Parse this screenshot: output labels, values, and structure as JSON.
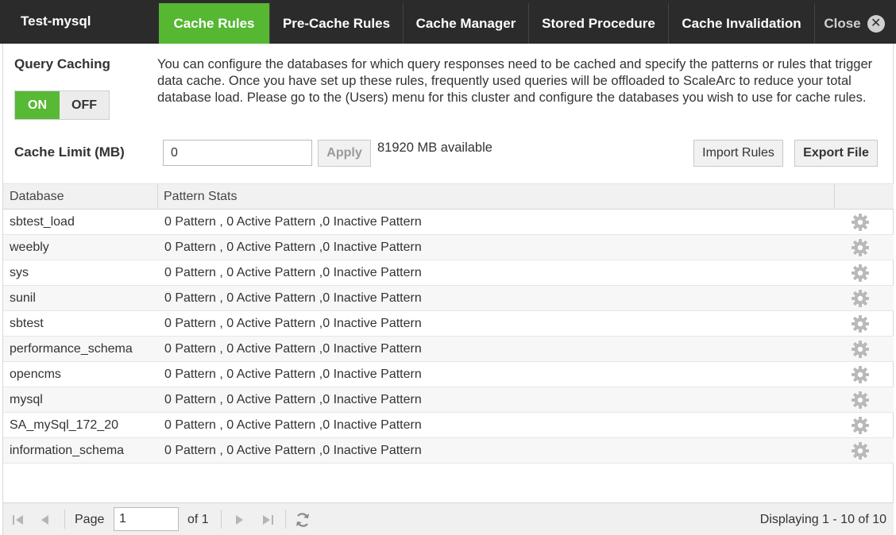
{
  "header": {
    "title": "Test-mysql",
    "tabs": [
      {
        "label": "Cache Rules",
        "active": true
      },
      {
        "label": "Pre-Cache Rules",
        "active": false
      },
      {
        "label": "Cache Manager",
        "active": false
      },
      {
        "label": "Stored Procedure",
        "active": false
      },
      {
        "label": "Cache Invalidation",
        "active": false
      }
    ],
    "close_label": "Close"
  },
  "query_caching": {
    "label": "Query Caching",
    "on_label": "ON",
    "off_label": "OFF",
    "state": "ON",
    "description": "You can configure the databases for which query responses need to be cached and specify the patterns or rules that trigger data cache. Once you have set up these rules, frequently used queries will be offloaded to ScaleArc to reduce your total database load. Please go to the (Users) menu for this cluster and configure the databases you wish to use for cache rules."
  },
  "cache_limit": {
    "label": "Cache Limit (MB)",
    "value": "0",
    "apply_label": "Apply",
    "available_text": "81920 MB available",
    "import_label": "Import Rules",
    "export_label": "Export File"
  },
  "table": {
    "columns": [
      "Database",
      "Pattern Stats"
    ],
    "rows": [
      {
        "database": "sbtest_load",
        "stats": "0 Pattern , 0 Active Pattern ,0 Inactive Pattern"
      },
      {
        "database": "weebly",
        "stats": "0 Pattern , 0 Active Pattern ,0 Inactive Pattern"
      },
      {
        "database": "sys",
        "stats": "0 Pattern , 0 Active Pattern ,0 Inactive Pattern"
      },
      {
        "database": "sunil",
        "stats": "0 Pattern , 0 Active Pattern ,0 Inactive Pattern"
      },
      {
        "database": "sbtest",
        "stats": "0 Pattern , 0 Active Pattern ,0 Inactive Pattern"
      },
      {
        "database": "performance_schema",
        "stats": "0 Pattern , 0 Active Pattern ,0 Inactive Pattern"
      },
      {
        "database": "opencms",
        "stats": "0 Pattern , 0 Active Pattern ,0 Inactive Pattern"
      },
      {
        "database": "mysql",
        "stats": "0 Pattern , 0 Active Pattern ,0 Inactive Pattern"
      },
      {
        "database": "SA_mySql_172_20",
        "stats": "0 Pattern , 0 Active Pattern ,0 Inactive Pattern"
      },
      {
        "database": "information_schema",
        "stats": "0 Pattern , 0 Active Pattern ,0 Inactive Pattern"
      }
    ],
    "row_action_icon": "gear-icon"
  },
  "pager": {
    "page_label": "Page",
    "page_value": "1",
    "of_label": "of 1",
    "display_text": "Displaying 1 - 10 of 10",
    "icons": [
      "first-page-icon",
      "prev-page-icon",
      "next-page-icon",
      "last-page-icon",
      "refresh-icon"
    ]
  },
  "colors": {
    "header_bg": "#2b2b2b",
    "accent_green": "#55b732",
    "toggle_on": "#58b935"
  }
}
